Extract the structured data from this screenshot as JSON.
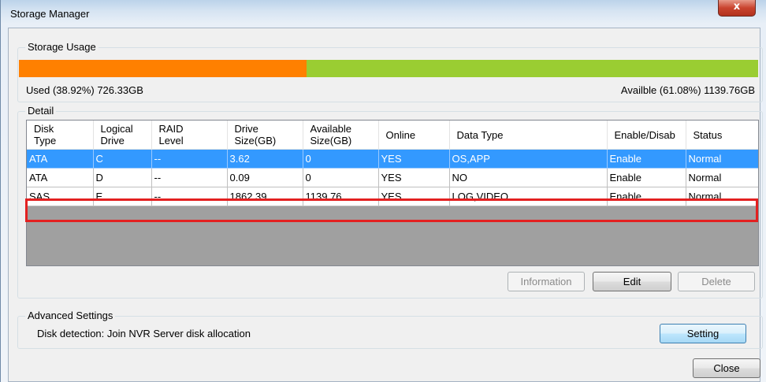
{
  "window": {
    "title": "Storage Manager",
    "close_glyph": "x"
  },
  "usage": {
    "label": "Storage Usage",
    "used_fraction": 0.3892,
    "used_text": "Used (38.92%) 726.33GB",
    "avail_text": "Availble (61.08%) 1139.76GB",
    "colors": {
      "used": "#ff8000",
      "available": "#9acd32"
    }
  },
  "detail": {
    "label": "Detail",
    "columns": [
      {
        "line1": "Disk",
        "line2": "Type"
      },
      {
        "line1": "Logical",
        "line2": "Drive"
      },
      {
        "line1": "RAID",
        "line2": "Level"
      },
      {
        "line1": "Drive",
        "line2": "Size(GB)"
      },
      {
        "line1": "Available",
        "line2": "Size(GB)"
      },
      {
        "line1": "Online",
        "line2": ""
      },
      {
        "line1": "Data Type",
        "line2": ""
      },
      {
        "line1": "Enable/Disab",
        "line2": ""
      },
      {
        "line1": "Status",
        "line2": ""
      }
    ],
    "rows": [
      [
        "ATA",
        "C",
        "--",
        "3.62",
        "0",
        "YES",
        "OS,APP",
        "Enable",
        "Normal"
      ],
      [
        "ATA",
        "D",
        "--",
        "0.09",
        "0",
        "YES",
        "NO",
        "Enable",
        "Normal"
      ],
      [
        "SAS",
        "E",
        "--",
        "1862.39",
        "1139.76",
        "YES",
        "LOG,VIDEO",
        "Enable",
        "Normal"
      ]
    ],
    "selected_row": 0,
    "highlighted_row": 2,
    "buttons": {
      "information": "Information",
      "edit": "Edit",
      "delete": "Delete"
    }
  },
  "advanced": {
    "label": "Advanced Settings",
    "text": "Disk detection: Join NVR Server disk allocation",
    "setting": "Setting"
  },
  "close": "Close",
  "colors": {
    "selection": "#3399ff",
    "highlight_border": "#e32020"
  }
}
